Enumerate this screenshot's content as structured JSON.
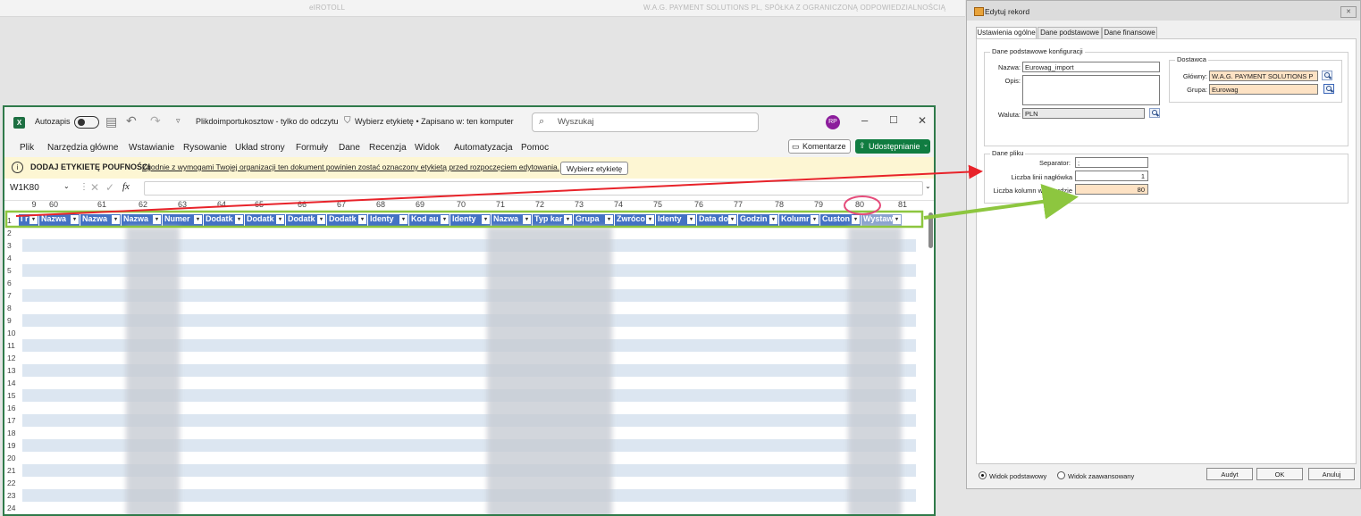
{
  "background": {
    "app_left": "eIROTOLL",
    "app_right": "W.A.G. PAYMENT SOLUTIONS PL, SPÓŁKA Z OGRANICZONĄ ODPOWIEDZIALNOŚCIĄ"
  },
  "excel": {
    "autosave_label": "Autozapis",
    "title": "Plikdoimportukosztow - tylko do odczytu",
    "label_status": "Wybierz etykietę • Zapisano w: ten komputer",
    "search_placeholder": "Wyszukaj",
    "user_initials": "RP",
    "menu": [
      "Plik",
      "Narzędzia główne",
      "Wstawianie",
      "Rysowanie",
      "Układ strony",
      "Formuły",
      "Dane",
      "Recenzja",
      "Widok",
      "Automatyzacja",
      "Pomoc"
    ],
    "comments_label": "Komentarze",
    "share_label": "Udostępnianie",
    "info_title": "DODAJ ETYKIETĘ POUFNOŚCI",
    "info_text": "Zgodnie z wymogami Twojej organizacji ten dokument powinien zostać oznaczony etykietą przed rozpoczęciem edytowania.",
    "info_button": "Wybierz etykietę",
    "namebox": "W1K80",
    "fx": "fx",
    "col_numbers": [
      "9",
      "60",
      "61",
      "62",
      "63",
      "64",
      "65",
      "66",
      "67",
      "68",
      "69",
      "70",
      "71",
      "72",
      "73",
      "74",
      "75",
      "76",
      "77",
      "78",
      "79",
      "80",
      "81"
    ],
    "header_cells": [
      "I r",
      "Nazwa",
      "Nazwa",
      "Nazwa",
      "Numer",
      "Dodatk",
      "Dodatk",
      "Dodatk",
      "Dodatk",
      "Identy",
      "Kod au",
      "Identy",
      "Nazwa",
      "Typ kar",
      "Grupa",
      "Zwróco",
      "Identy",
      "Data do",
      "Godzin",
      "Kolumr",
      "Custon",
      "Wystaw"
    ],
    "row_numbers": [
      "1",
      "2",
      "3",
      "4",
      "5",
      "6",
      "7",
      "8",
      "9",
      "10",
      "11",
      "12",
      "13",
      "14",
      "15",
      "16",
      "17",
      "18",
      "19",
      "20",
      "21",
      "22",
      "23",
      "24"
    ]
  },
  "dialog": {
    "title": "Edytuj rekord",
    "tabs": [
      "Ustawienia ogólne",
      "Dane podstawowe",
      "Dane finansowe"
    ],
    "config_group": "Dane podstawowe konfiguracji",
    "name_label": "Nazwa:",
    "name_value": "Eurowag_import",
    "desc_label": "Opis:",
    "currency_label": "Waluta:",
    "currency_value": "PLN",
    "supplier_group": "Dostawca",
    "main_label": "Główny:",
    "main_value": "W.A.G. PAYMENT SOLUTIONS P",
    "group_label": "Grupa:",
    "group_value": "Eurowag",
    "file_group": "Dane pliku",
    "separator_label": "Separator:",
    "separator_value": ";",
    "header_lines_label": "Liczba linii nagłówka",
    "header_lines_value": "1",
    "columns_label": "Liczba kolumn w rekordzie",
    "columns_value": "80",
    "view_basic": "Widok podstawowy",
    "view_advanced": "Widok zaawansowany",
    "btn_audit": "Audyt",
    "btn_ok": "OK",
    "btn_cancel": "Anuluj"
  },
  "colors": {
    "excel_green": "#107c41",
    "header_blue": "#4472c4",
    "band_blue": "#dce6f1",
    "peach": "#fde2c4",
    "arrow_red": "#e8232a",
    "arrow_green": "#8dc63f"
  }
}
